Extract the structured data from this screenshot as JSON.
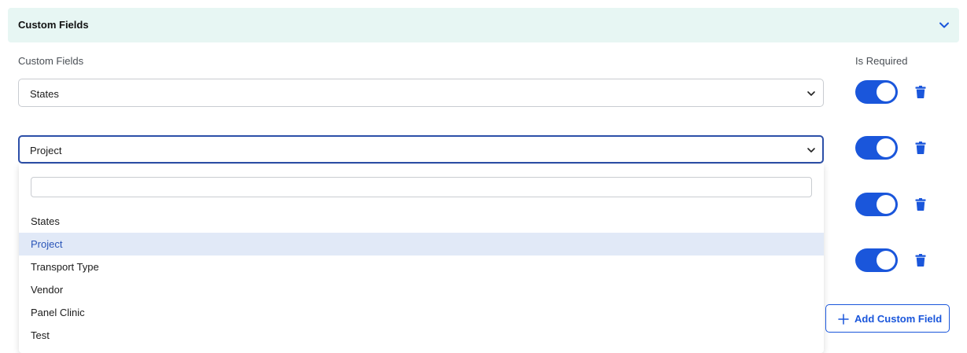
{
  "section": {
    "title": "Custom Fields",
    "chevron_icon": "chevron-down-icon"
  },
  "columns": {
    "custom_fields_label": "Custom Fields",
    "is_required_label": "Is Required"
  },
  "rows": [
    {
      "value": "States",
      "required": true
    },
    {
      "value": "Project",
      "required": true,
      "open": true
    },
    {
      "required": true
    },
    {
      "required": true
    }
  ],
  "dropdown": {
    "search_placeholder": "",
    "options": [
      "States",
      "Project",
      "Transport Type",
      "Vendor",
      "Panel Clinic",
      "Test"
    ],
    "selected": "Project"
  },
  "add_button": {
    "label": "Add Custom Field",
    "icon": "plus-icon"
  },
  "colors": {
    "accent": "#1a56db",
    "header_bg": "#e7f6f3",
    "selected_option_bg": "#e1e9f7",
    "selected_option_text": "#2a55b8"
  }
}
